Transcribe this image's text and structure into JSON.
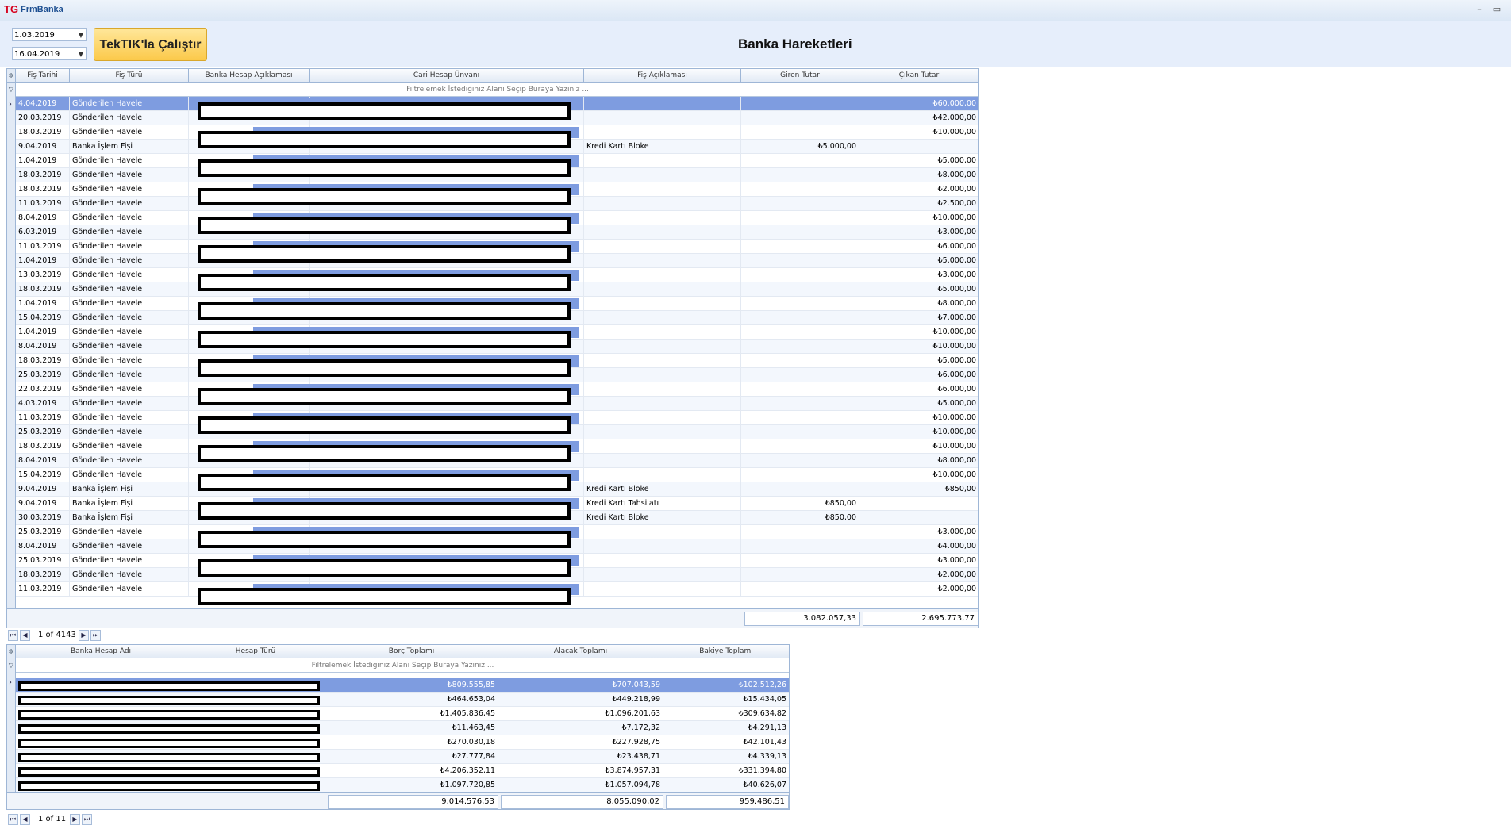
{
  "window": {
    "title": "FrmBanka",
    "logo": "TG"
  },
  "toolbar": {
    "date_start": "1.03.2019",
    "date_end": "16.04.2019",
    "run_label": "TekTIK'la Çalıştır"
  },
  "page_title": "Banka Hareketleri",
  "top_grid": {
    "columns": [
      "Fiş Tarihi",
      "Fiş Türü",
      "Banka Hesap Açıklaması",
      "Cari Hesap Ünvanı",
      "Fiş Açıklaması",
      "Giren Tutar",
      "Çıkan Tutar"
    ],
    "filter_placeholder": "Filtrelemek İstediğiniz Alanı Seçip Buraya Yazınız ...",
    "rows": [
      {
        "date": "4.04.2019",
        "type": "Gönderilen Havele",
        "desc": "",
        "in": "",
        "out": "₺60.000,00"
      },
      {
        "date": "20.03.2019",
        "type": "Gönderilen Havele",
        "desc": "",
        "in": "",
        "out": "₺42.000,00"
      },
      {
        "date": "18.03.2019",
        "type": "Gönderilen Havele",
        "desc": "",
        "in": "",
        "out": "₺10.000,00"
      },
      {
        "date": "9.04.2019",
        "type": "Banka İşlem Fişi",
        "desc": "Kredi Kartı Bloke",
        "in": "₺5.000,00",
        "out": ""
      },
      {
        "date": "1.04.2019",
        "type": "Gönderilen Havele",
        "desc": "",
        "in": "",
        "out": "₺5.000,00"
      },
      {
        "date": "18.03.2019",
        "type": "Gönderilen Havele",
        "desc": "",
        "in": "",
        "out": "₺8.000,00"
      },
      {
        "date": "18.03.2019",
        "type": "Gönderilen Havele",
        "desc": "",
        "in": "",
        "out": "₺2.000,00"
      },
      {
        "date": "11.03.2019",
        "type": "Gönderilen Havele",
        "desc": "",
        "in": "",
        "out": "₺2.500,00"
      },
      {
        "date": "8.04.2019",
        "type": "Gönderilen Havele",
        "desc": "",
        "in": "",
        "out": "₺10.000,00"
      },
      {
        "date": "6.03.2019",
        "type": "Gönderilen Havele",
        "desc": "",
        "in": "",
        "out": "₺3.000,00"
      },
      {
        "date": "11.03.2019",
        "type": "Gönderilen Havele",
        "desc": "",
        "in": "",
        "out": "₺6.000,00"
      },
      {
        "date": "1.04.2019",
        "type": "Gönderilen Havele",
        "desc": "",
        "in": "",
        "out": "₺5.000,00"
      },
      {
        "date": "13.03.2019",
        "type": "Gönderilen Havele",
        "desc": "",
        "in": "",
        "out": "₺3.000,00"
      },
      {
        "date": "18.03.2019",
        "type": "Gönderilen Havele",
        "desc": "",
        "in": "",
        "out": "₺5.000,00"
      },
      {
        "date": "1.04.2019",
        "type": "Gönderilen Havele",
        "desc": "",
        "in": "",
        "out": "₺8.000,00"
      },
      {
        "date": "15.04.2019",
        "type": "Gönderilen Havele",
        "desc": "",
        "in": "",
        "out": "₺7.000,00"
      },
      {
        "date": "1.04.2019",
        "type": "Gönderilen Havele",
        "desc": "",
        "in": "",
        "out": "₺10.000,00"
      },
      {
        "date": "8.04.2019",
        "type": "Gönderilen Havele",
        "desc": "",
        "in": "",
        "out": "₺10.000,00"
      },
      {
        "date": "18.03.2019",
        "type": "Gönderilen Havele",
        "desc": "",
        "in": "",
        "out": "₺5.000,00"
      },
      {
        "date": "25.03.2019",
        "type": "Gönderilen Havele",
        "desc": "",
        "in": "",
        "out": "₺6.000,00"
      },
      {
        "date": "22.03.2019",
        "type": "Gönderilen Havele",
        "desc": "",
        "in": "",
        "out": "₺6.000,00"
      },
      {
        "date": "4.03.2019",
        "type": "Gönderilen Havele",
        "desc": "",
        "in": "",
        "out": "₺5.000,00"
      },
      {
        "date": "11.03.2019",
        "type": "Gönderilen Havele",
        "desc": "",
        "in": "",
        "out": "₺10.000,00"
      },
      {
        "date": "25.03.2019",
        "type": "Gönderilen Havele",
        "desc": "",
        "in": "",
        "out": "₺10.000,00"
      },
      {
        "date": "18.03.2019",
        "type": "Gönderilen Havele",
        "desc": "",
        "in": "",
        "out": "₺10.000,00"
      },
      {
        "date": "8.04.2019",
        "type": "Gönderilen Havele",
        "desc": "",
        "in": "",
        "out": "₺8.000,00"
      },
      {
        "date": "15.04.2019",
        "type": "Gönderilen Havele",
        "desc": "",
        "in": "",
        "out": "₺10.000,00"
      },
      {
        "date": "9.04.2019",
        "type": "Banka İşlem Fişi",
        "desc": "Kredi Kartı Bloke",
        "in": "",
        "out": "₺850,00"
      },
      {
        "date": "9.04.2019",
        "type": "Banka İşlem Fişi",
        "desc": "Kredi Kartı Tahsilatı",
        "in": "₺850,00",
        "out": ""
      },
      {
        "date": "30.03.2019",
        "type": "Banka İşlem Fişi",
        "desc": "Kredi Kartı Bloke",
        "in": "₺850,00",
        "out": ""
      },
      {
        "date": "25.03.2019",
        "type": "Gönderilen Havele",
        "desc": "",
        "in": "",
        "out": "₺3.000,00"
      },
      {
        "date": "8.04.2019",
        "type": "Gönderilen Havele",
        "desc": "",
        "in": "",
        "out": "₺4.000,00"
      },
      {
        "date": "25.03.2019",
        "type": "Gönderilen Havele",
        "desc": "",
        "in": "",
        "out": "₺3.000,00"
      },
      {
        "date": "18.03.2019",
        "type": "Gönderilen Havele",
        "desc": "",
        "in": "",
        "out": "₺2.000,00"
      },
      {
        "date": "11.03.2019",
        "type": "Gönderilen Havele",
        "desc": "",
        "in": "",
        "out": "₺2.000,00"
      }
    ],
    "total_in": "3.082.057,33",
    "total_out": "2.695.773,77",
    "pager": "1 of 4143"
  },
  "bottom_grid": {
    "columns": [
      "Banka Hesap Adı",
      "Hesap Türü",
      "Borç Toplamı",
      "Alacak Toplamı",
      "Bakiye Toplamı"
    ],
    "filter_placeholder": "Filtrelemek İstediğiniz Alanı Seçip Buraya Yazınız ...",
    "rows": [
      {
        "borc": "₺809.555,85",
        "alacak": "₺707.043,59",
        "bakiye": "₺102.512,26"
      },
      {
        "borc": "₺464.653,04",
        "alacak": "₺449.218,99",
        "bakiye": "₺15.434,05"
      },
      {
        "borc": "₺1.405.836,45",
        "alacak": "₺1.096.201,63",
        "bakiye": "₺309.634,82"
      },
      {
        "borc": "₺11.463,45",
        "alacak": "₺7.172,32",
        "bakiye": "₺4.291,13"
      },
      {
        "borc": "₺270.030,18",
        "alacak": "₺227.928,75",
        "bakiye": "₺42.101,43"
      },
      {
        "borc": "₺27.777,84",
        "alacak": "₺23.438,71",
        "bakiye": "₺4.339,13"
      },
      {
        "borc": "₺4.206.352,11",
        "alacak": "₺3.874.957,31",
        "bakiye": "₺331.394,80"
      },
      {
        "borc": "₺1.097.720,85",
        "alacak": "₺1.057.094,78",
        "bakiye": "₺40.626,07"
      }
    ],
    "total_borc": "9.014.576,53",
    "total_alacak": "8.055.090,02",
    "total_bakiye": "959.486,51",
    "pager": "1 of 11"
  }
}
